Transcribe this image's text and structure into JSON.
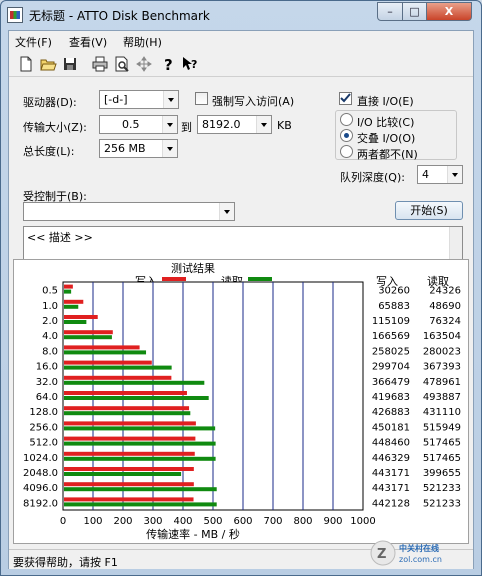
{
  "window": {
    "title": "无标题 - ATTO Disk Benchmark",
    "minimize": "–",
    "maximize": "□",
    "close": "X"
  },
  "menu": {
    "file": "文件(F)",
    "view": "查看(V)",
    "help": "帮助(H)"
  },
  "toolbar": {
    "icons": [
      "new-icon",
      "open-icon",
      "save-icon",
      "print-icon",
      "print-preview-icon",
      "move-icon",
      "help-icon",
      "context-help-icon"
    ]
  },
  "settings": {
    "drive_label": "驱动器(D):",
    "drive_value": "[-d-]",
    "force_write_label": "强制写入访问(A)",
    "force_write_checked": false,
    "transfer_size_label": "传输大小(Z):",
    "transfer_from": "0.5",
    "transfer_to_label": "到",
    "transfer_to": "8192.0",
    "transfer_unit": "KB",
    "total_length_label": "总长度(L):",
    "total_length_value": "256 MB",
    "direct_io_label": "直接 I/O(E)",
    "direct_io_checked": true,
    "io_compare_label": "I/O 比较(C)",
    "overlapped_io_label": "交叠 I/O(O)",
    "neither_label": "两者都不(N)",
    "selected_mode": "overlapped",
    "queue_depth_label": "队列深度(Q):",
    "queue_depth_value": "4",
    "controlled_by_label": "受控制于(B):",
    "controlled_by_value": "",
    "start_button": "开始(S)",
    "description": "<< 描述 >>"
  },
  "results": {
    "title": "测试结果",
    "write_legend": "写入",
    "read_legend": "读取",
    "write_col": "写入",
    "read_col": "读取",
    "write_color": "#e02020",
    "read_color": "#108a10",
    "xlabel": "传输速率 - MB / 秒"
  },
  "chart_data": {
    "type": "bar",
    "title": "测试结果",
    "xlabel": "传输速率 - MB / 秒",
    "xlim": [
      0,
      1000
    ],
    "xticks": [
      0,
      100,
      200,
      300,
      400,
      500,
      600,
      700,
      800,
      900,
      1000
    ],
    "categories": [
      "0.5",
      "1.0",
      "2.0",
      "4.0",
      "8.0",
      "16.0",
      "32.0",
      "64.0",
      "128.0",
      "256.0",
      "512.0",
      "1024.0",
      "2048.0",
      "4096.0",
      "8192.0"
    ],
    "series": [
      {
        "name": "写入",
        "values": [
          30260,
          65883,
          115109,
          166569,
          258025,
          299704,
          366479,
          419683,
          426883,
          450181,
          448460,
          446329,
          443171,
          443171,
          442128
        ]
      },
      {
        "name": "读取",
        "values": [
          24326,
          48690,
          76324,
          163504,
          280023,
          367393,
          478961,
          493887,
          431110,
          515949,
          517465,
          517465,
          399655,
          521233,
          521233
        ]
      }
    ]
  },
  "status": {
    "text": "要获得帮助，请按 F1",
    "watermark": "中关村在线 zol.com.cn"
  }
}
